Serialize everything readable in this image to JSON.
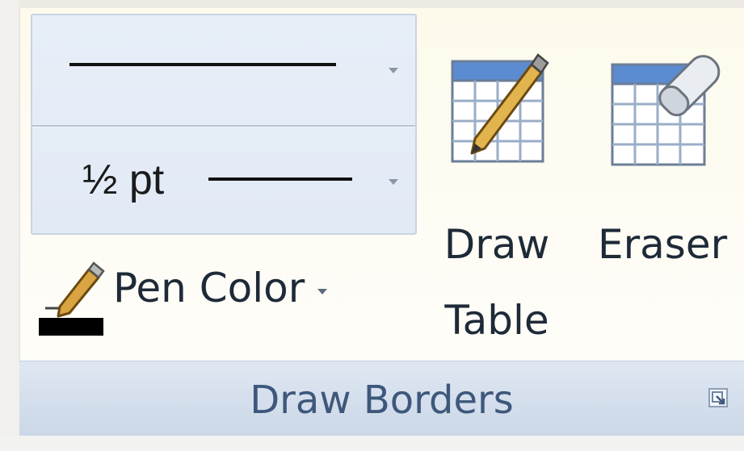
{
  "group": {
    "title": "Draw Borders"
  },
  "line_style": {
    "selected": "solid"
  },
  "line_weight": {
    "label": "½ pt"
  },
  "pen_color": {
    "label": "Pen Color",
    "color": "#000000"
  },
  "draw_table": {
    "label_line1": "Draw",
    "label_line2": "Table"
  },
  "eraser": {
    "label": "Eraser"
  },
  "colors": {
    "ribbon_bg": "#fdfbf2",
    "footer_bg": "#d6e0ee",
    "footer_text": "#3e587c",
    "table_header": "#5b8bd0",
    "box_bg": "#e4ecf7"
  }
}
